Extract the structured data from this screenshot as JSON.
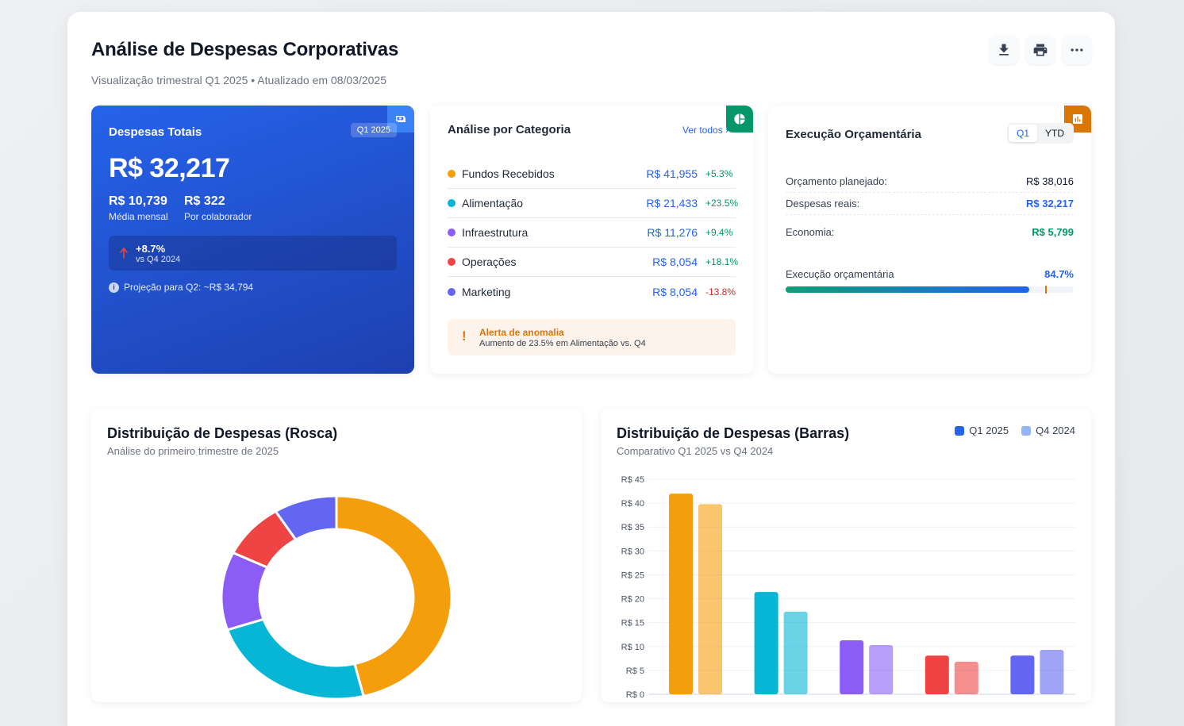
{
  "header": {
    "title": "Análise de Despesas Corporativas",
    "subtitle": "Visualização trimestral Q1 2025 • Atualizado em 08/03/2025",
    "actions": [
      "download-icon",
      "print-icon",
      "more-icon"
    ]
  },
  "total_card": {
    "title": "Despesas Totais",
    "period": "Q1 2025",
    "value": "R$ 32,217",
    "monthly_value": "R$ 10,739",
    "monthly_label": "Média mensal",
    "per_employee_value": "R$ 322",
    "per_employee_label": "Por colaborador",
    "trend_pct": "+8.7%",
    "trend_vs": "vs Q4 2024",
    "projection": "Projeção para Q2: ~R$ 34,794",
    "corner_icon": "money-icon",
    "accent": "#2563eb"
  },
  "category_card": {
    "title": "Análise por Categoria",
    "link": "Ver todos",
    "corner_icon": "pie-icon",
    "corner_color": "#059669",
    "items": [
      {
        "name": "Fundos Recebidos",
        "value": "R$ 41,955",
        "change": "+5.3%",
        "color": "#f59e0b",
        "positive": true
      },
      {
        "name": "Alimentação",
        "value": "R$ 21,433",
        "change": "+23.5%",
        "color": "#06b6d4",
        "positive": true
      },
      {
        "name": "Infraestrutura",
        "value": "R$ 11,276",
        "change": "+9.4%",
        "color": "#8b5cf6",
        "positive": true
      },
      {
        "name": "Operações",
        "value": "R$ 8,054",
        "change": "+18.1%",
        "color": "#ef4444",
        "positive": true
      },
      {
        "name": "Marketing",
        "value": "R$ 8,054",
        "change": "-13.8%",
        "color": "#6366f1",
        "positive": false
      }
    ],
    "alert_title": "Alerta de anomalia",
    "alert_text": "Aumento de 23.5% em Alimentação vs. Q4"
  },
  "exec_card": {
    "title": "Execução Orçamentária",
    "tabs": [
      "Q1",
      "YTD"
    ],
    "active_tab": "Q1",
    "corner_icon": "chart-icon",
    "corner_color": "#d97706",
    "planned_label": "Orçamento planejado:",
    "planned_value": "R$ 38,016",
    "actual_label": "Despesas reais:",
    "actual_value": "R$ 32,217",
    "savings_label": "Economia:",
    "savings_value": "R$ 5,799",
    "progress_label": "Execução orçamentária",
    "progress_value": "84.7%",
    "progress_fraction": 0.847,
    "marker_fraction": 0.9
  },
  "donut_chart": {
    "title": "Distribuição de Despesas (Rosca)",
    "subtitle": "Análise do primeiro trimestre de 2025"
  },
  "bar_chart": {
    "title": "Distribuição de Despesas (Barras)",
    "subtitle": "Comparativo Q1 2025 vs Q4 2024"
  },
  "chart_data": [
    {
      "type": "pie",
      "title": "Distribuição de Despesas (Rosca)",
      "subtitle": "Análise do primeiro trimestre de 2025",
      "categories": [
        "Fundos Recebidos",
        "Alimentação",
        "Infraestrutura",
        "Operações",
        "Marketing"
      ],
      "values": [
        41.955,
        21.433,
        11.276,
        8.054,
        8.054
      ],
      "colors": [
        "#f59e0b",
        "#06b6d4",
        "#8b5cf6",
        "#ef4444",
        "#6366f1"
      ],
      "donut": true
    },
    {
      "type": "bar",
      "title": "Distribuição de Despesas (Barras)",
      "subtitle": "Comparativo Q1 2025 vs Q4 2024",
      "categories": [
        "Fundos Recebidos",
        "Alimentação",
        "Infraestrutura",
        "Operações",
        "Marketing"
      ],
      "series": [
        {
          "name": "Q1 2025",
          "values": [
            42,
            21.4,
            11.3,
            8.1,
            8.1
          ]
        },
        {
          "name": "Q4 2024",
          "values": [
            39.8,
            17.3,
            10.3,
            6.8,
            9.3
          ]
        }
      ],
      "colors": [
        "#f59e0b",
        "#06b6d4",
        "#8b5cf6",
        "#ef4444",
        "#6366f1"
      ],
      "legend_colors": [
        "#2563eb",
        "#93b4f5"
      ],
      "ylim": [
        0,
        45
      ],
      "yticks": [
        "R$ 0",
        "R$ 5",
        "R$ 10",
        "R$ 15",
        "R$ 20",
        "R$ 25",
        "R$ 30",
        "R$ 35",
        "R$ 40",
        "R$ 45"
      ],
      "grid": true,
      "legend": "top-right"
    }
  ]
}
